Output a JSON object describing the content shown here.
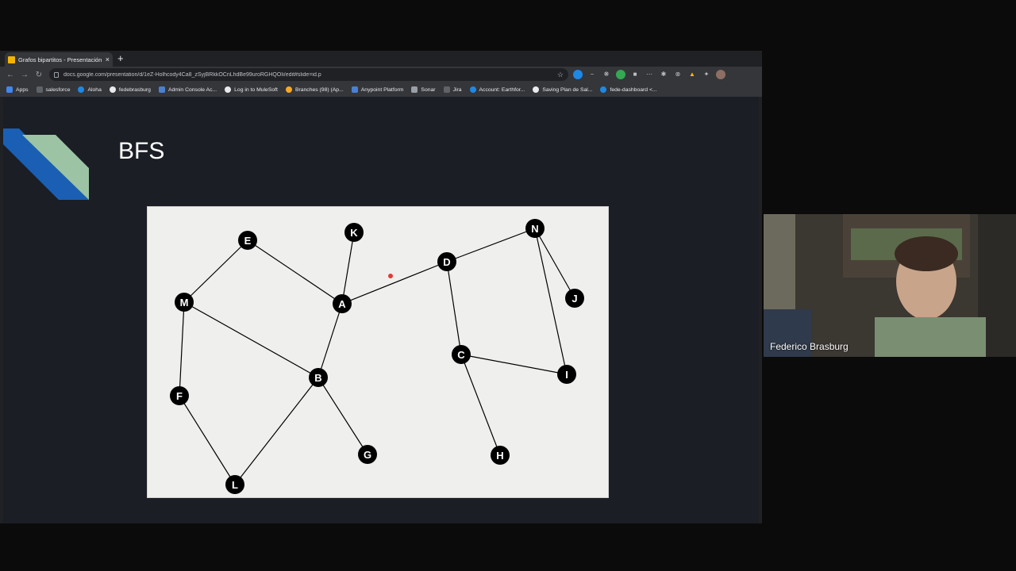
{
  "browser": {
    "tab_title": "Grafos bipartitos - Presentación",
    "tab_close": "×",
    "new_tab": "+",
    "url": "docs.google.com/presentation/d/1eZ-Holhcody4Ca8_zSyjBRkkOCnLhdBe99uroRGHQOIi/edit#slide=id.p",
    "bookmarks": [
      "Apps",
      "salesforce",
      "Aloha",
      "fedebrasburg",
      "Admin Console Ac...",
      "Log in to MuleSoft",
      "Branches (98) (Ap...",
      "Anypoint Platform",
      "Sonar",
      "Jira",
      "Account: Earthfor...",
      "Saving Plan de Sal...",
      "fede-dashboard <..."
    ]
  },
  "slide": {
    "title": "BFS",
    "accent_colors": [
      "#1a5fb4",
      "#9cc4a4"
    ],
    "graph": {
      "nodes": [
        {
          "id": "E"
        },
        {
          "id": "K"
        },
        {
          "id": "N"
        },
        {
          "id": "D"
        },
        {
          "id": "M"
        },
        {
          "id": "A"
        },
        {
          "id": "J"
        },
        {
          "id": "C"
        },
        {
          "id": "I"
        },
        {
          "id": "B"
        },
        {
          "id": "F"
        },
        {
          "id": "G"
        },
        {
          "id": "H"
        },
        {
          "id": "L"
        }
      ],
      "edges": [
        [
          "E",
          "M"
        ],
        [
          "E",
          "A"
        ],
        [
          "K",
          "A"
        ],
        [
          "A",
          "D"
        ],
        [
          "A",
          "B"
        ],
        [
          "M",
          "B"
        ],
        [
          "M",
          "F"
        ],
        [
          "F",
          "L"
        ],
        [
          "L",
          "B"
        ],
        [
          "B",
          "G"
        ],
        [
          "D",
          "N"
        ],
        [
          "D",
          "C"
        ],
        [
          "N",
          "J"
        ],
        [
          "N",
          "I"
        ],
        [
          "C",
          "I"
        ],
        [
          "C",
          "H"
        ]
      ],
      "node_color": "#000000",
      "edge_color": "#000000",
      "pointer_color": "#e53935"
    }
  },
  "video": {
    "participant_name": "Federico Brasburg"
  }
}
